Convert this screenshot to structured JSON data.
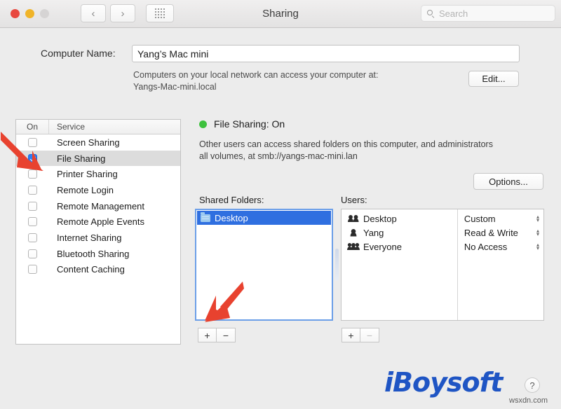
{
  "window": {
    "title": "Sharing",
    "traffic_lights": [
      "close",
      "minimize",
      "zoom"
    ],
    "nav": {
      "back": "‹",
      "forward": "›"
    },
    "grid_icon": "apps-grid-icon"
  },
  "search": {
    "placeholder": "Search",
    "value": "",
    "icon": "search-icon"
  },
  "computer_name": {
    "label": "Computer Name:",
    "value": "Yang’s Mac mini",
    "note_line1": "Computers on your local network can access your computer at:",
    "note_line2": "Yangs-Mac-mini.local",
    "edit_button": "Edit..."
  },
  "services": {
    "columns": [
      "On",
      "Service"
    ],
    "rows": [
      {
        "name": "Screen Sharing",
        "on": false,
        "selected": false
      },
      {
        "name": "File Sharing",
        "on": true,
        "selected": true
      },
      {
        "name": "Printer Sharing",
        "on": false,
        "selected": false
      },
      {
        "name": "Remote Login",
        "on": false,
        "selected": false
      },
      {
        "name": "Remote Management",
        "on": false,
        "selected": false
      },
      {
        "name": "Remote Apple Events",
        "on": false,
        "selected": false
      },
      {
        "name": "Internet Sharing",
        "on": false,
        "selected": false
      },
      {
        "name": "Bluetooth Sharing",
        "on": false,
        "selected": false
      },
      {
        "name": "Content Caching",
        "on": false,
        "selected": false
      }
    ]
  },
  "detail": {
    "status_title": "File Sharing: On",
    "status_color": "#3ec13e",
    "description_line1": "Other users can access shared folders on this computer, and administrators",
    "description_line2": "all volumes, at smb://yangs-mac-mini.lan",
    "options_button": "Options..."
  },
  "shared_folders": {
    "label": "Shared Folders:",
    "items": [
      {
        "name": "Desktop",
        "icon": "folder-icon",
        "selected": true
      }
    ],
    "add_button": "+",
    "remove_button": "−"
  },
  "users": {
    "label": "Users:",
    "rows": [
      {
        "name": "Desktop",
        "icon": "group-icon",
        "permission": "Custom"
      },
      {
        "name": "Yang",
        "icon": "person-icon",
        "permission": "Read & Write"
      },
      {
        "name": "Everyone",
        "icon": "everyone-icon",
        "permission": "No Access"
      }
    ],
    "add_button": "+",
    "remove_button": "−"
  },
  "annotations": [
    {
      "name": "arrow-to-file-sharing-checkbox",
      "color": "#e8422f",
      "direction": "down-right"
    },
    {
      "name": "arrow-to-add-folder-button",
      "color": "#e8422f",
      "direction": "down-left"
    }
  ],
  "branding": {
    "logo_text": "iBoysoft",
    "logo_color": "#1f55c4",
    "help_button": "?",
    "watermark": "wsxdn.com"
  }
}
